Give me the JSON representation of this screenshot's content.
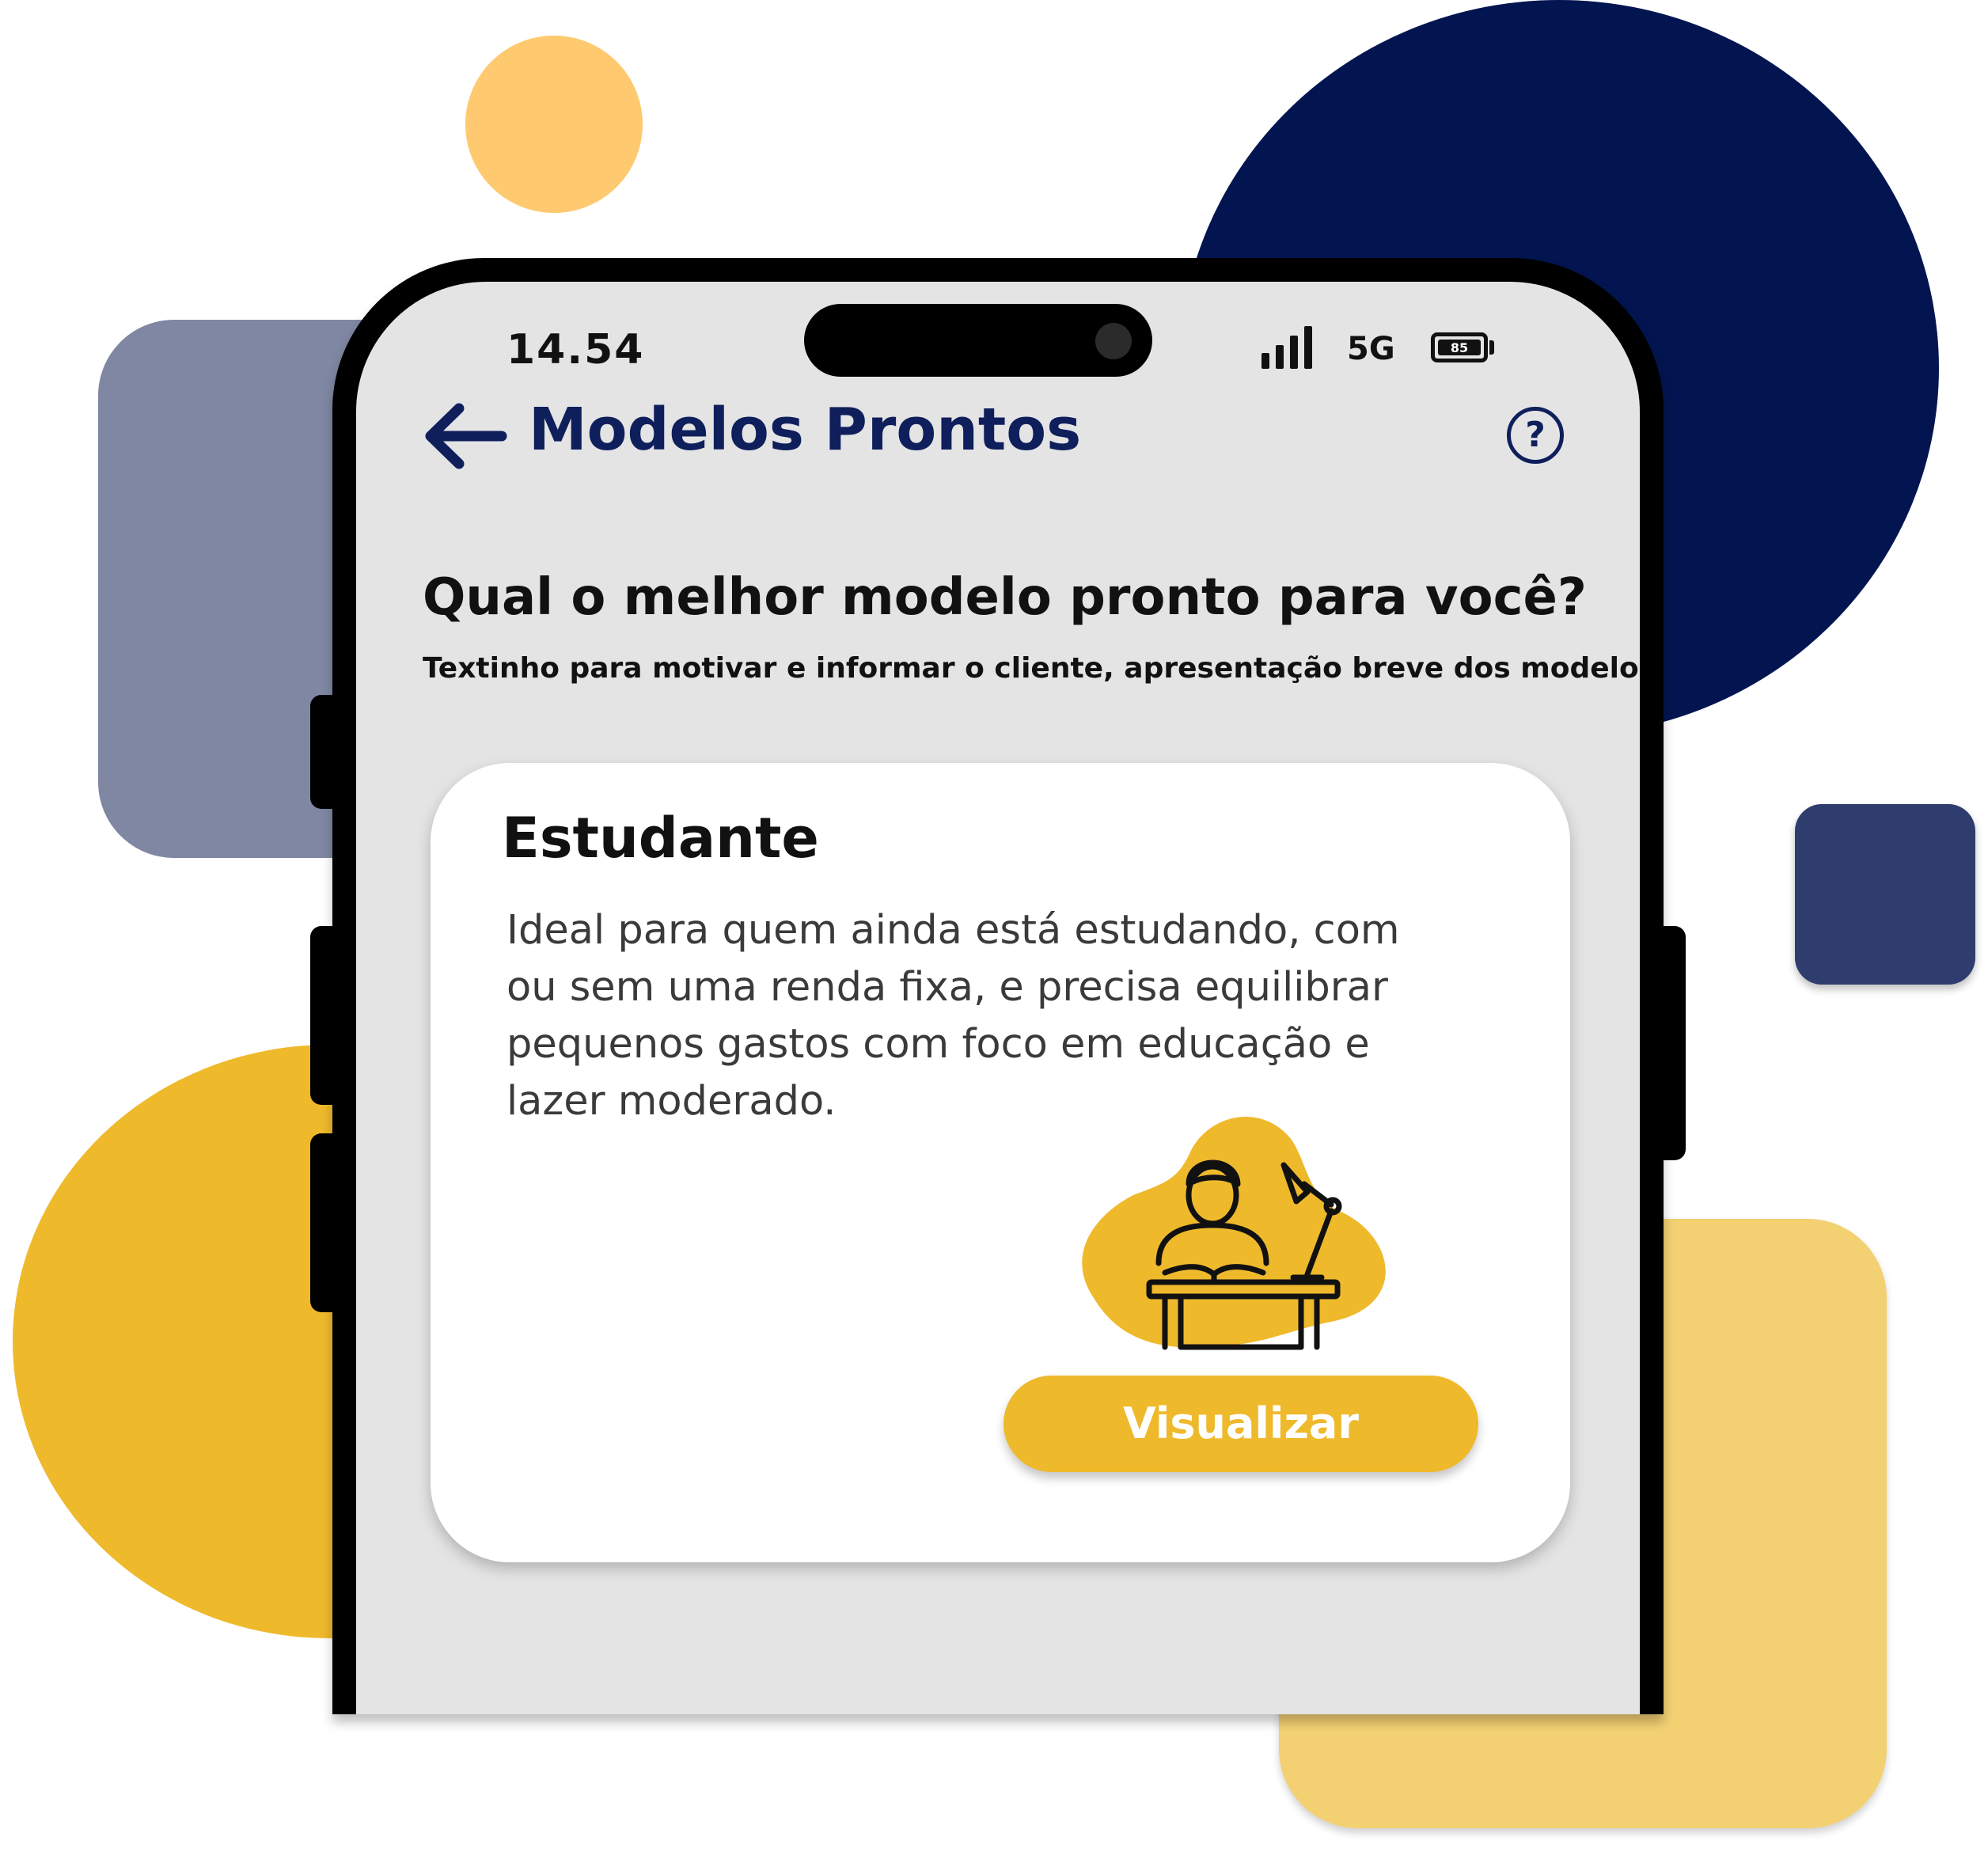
{
  "status_bar": {
    "time": "14.54",
    "network": "5G",
    "battery": "85",
    "icons": [
      "signal-icon",
      "battery-icon"
    ]
  },
  "header": {
    "title": "Modelos Prontos",
    "back_icon": "arrow-left-icon",
    "help_icon": "help-icon",
    "help_symbol": "?"
  },
  "intro": {
    "question": "Qual o melhor modelo pronto para você?",
    "subtitle": "Textinho para motivar e informar o cliente, apresentação breve dos modelos"
  },
  "card": {
    "title": "Estudante",
    "description": "Ideal para quem ainda está estudando, com ou sem uma renda fixa, e precisa equilibrar pequenos gastos com foco em educação e lazer moderado.",
    "illustration_icon": "student-desk-icon",
    "button_label": "Visualizar"
  },
  "colors": {
    "navy": "#021550",
    "title_navy": "#0F1F5C",
    "accent_yellow": "#EFB92C",
    "screen_bg": "#E4E4E4"
  }
}
